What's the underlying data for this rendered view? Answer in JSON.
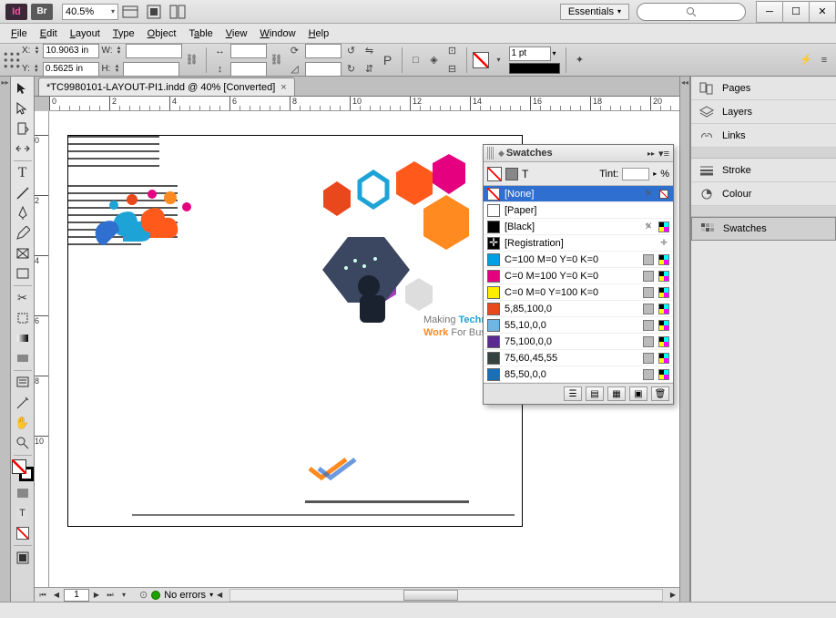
{
  "titlebar": {
    "zoom": "40.5%",
    "workspace": "Essentials"
  },
  "menu": [
    "File",
    "Edit",
    "Layout",
    "Type",
    "Object",
    "Table",
    "View",
    "Window",
    "Help"
  ],
  "control": {
    "x": "10.9063 in",
    "y": "0.5625 in",
    "w": "",
    "h": "",
    "stroke_weight": "1 pt"
  },
  "doc": {
    "tab": "*TC9980101-LAYOUT-PI1.indd @ 40% [Converted]",
    "page_current": "1",
    "preflight": "No errors"
  },
  "ruler": {
    "h": [
      0,
      2,
      4,
      6,
      8,
      10,
      12,
      14,
      16,
      18,
      20
    ],
    "v": [
      0,
      2,
      4,
      6,
      8,
      10
    ]
  },
  "panels": [
    "Pages",
    "Layers",
    "Links",
    "Stroke",
    "Colour",
    "Swatches"
  ],
  "swatches": {
    "title": "Swatches",
    "tint_label": "Tint:",
    "tint_suffix": "%",
    "list": [
      {
        "name": "[None]",
        "type": "none",
        "sel": true,
        "lock": true
      },
      {
        "name": "[Paper]",
        "color": "#ffffff"
      },
      {
        "name": "[Black]",
        "color": "#000000",
        "lock": true,
        "cmyk": true
      },
      {
        "name": "[Registration]",
        "type": "reg",
        "reg": true
      },
      {
        "name": "C=100 M=0 Y=0 K=0",
        "color": "#00a0e3",
        "cmyk": true,
        "proc": true
      },
      {
        "name": "C=0 M=100 Y=0 K=0",
        "color": "#e4007f",
        "cmyk": true,
        "proc": true
      },
      {
        "name": "C=0 M=0 Y=100 K=0",
        "color": "#ffee00",
        "cmyk": true,
        "proc": true
      },
      {
        "name": "5,85,100,0",
        "color": "#e9471c",
        "cmyk": true,
        "proc": true
      },
      {
        "name": "55,10,0,0",
        "color": "#6fb6e4",
        "cmyk": true,
        "proc": true
      },
      {
        "name": "75,100,0,0",
        "color": "#5a2a8e",
        "cmyk": true,
        "proc": true
      },
      {
        "name": "75,60,45,55",
        "color": "#36423f",
        "cmyk": true,
        "proc": true
      },
      {
        "name": "85,50,0,0",
        "color": "#1b6fb5",
        "cmyk": true,
        "proc": true
      }
    ]
  },
  "artwork": {
    "tagline": {
      "l1a": "Making ",
      "l1b": "Technology",
      "l2a": "Work ",
      "l2b": "For Business"
    }
  }
}
